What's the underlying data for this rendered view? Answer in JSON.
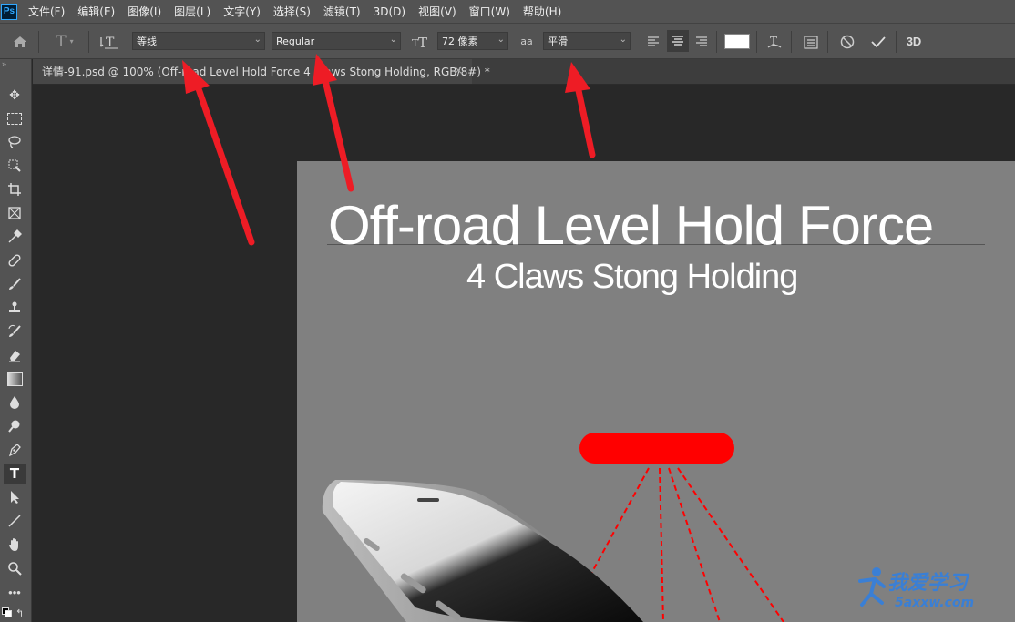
{
  "app": {
    "logo": "Ps"
  },
  "menu": [
    "文件(F)",
    "编辑(E)",
    "图像(I)",
    "图层(L)",
    "文字(Y)",
    "选择(S)",
    "滤镜(T)",
    "3D(D)",
    "视图(V)",
    "窗口(W)",
    "帮助(H)"
  ],
  "options": {
    "font_family": "等线",
    "font_style": "Regular",
    "font_size": "72 像素",
    "antialias_label": "aa",
    "antialias": "平滑",
    "mode_3d": "3D"
  },
  "document": {
    "tab_title": "详情-91.psd @ 100% (Off-road Level Hold Force 4 Claws Stong Holding, RGB/8#) *",
    "tab_close": "×"
  },
  "canvas": {
    "headline": "Off-road Level Hold Force",
    "subline": "4 Claws Stong Holding"
  },
  "watermark": {
    "text": "我爱学习",
    "url": "5axxw.com"
  },
  "colors": {
    "accent_red": "#ff0000",
    "annotation_red": "#ee1c25",
    "swatch": "#ffffff"
  }
}
